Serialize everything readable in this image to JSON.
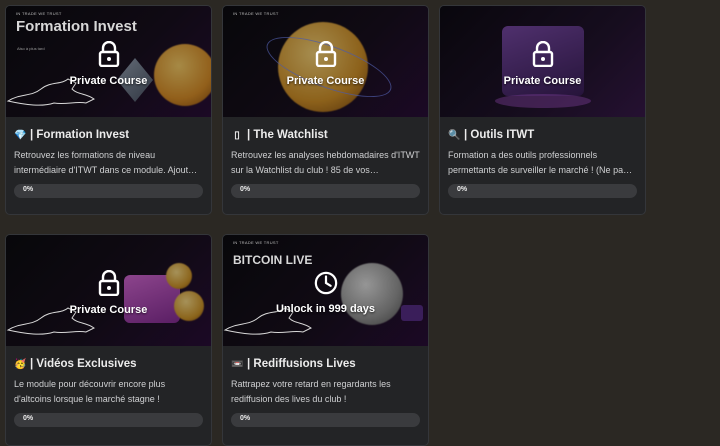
{
  "courses": [
    {
      "brand": "IN TRADE WE TRUST",
      "thumb_title": "Formation Invest",
      "thumb_sub": "Also à plus tard",
      "overlay": "Private Course",
      "emoji": "💎",
      "title": "| Formation Invest",
      "desc": "Retrouvez les formations de niveau intermédiaire d'ITWT dans ce module. Ajout…",
      "progress_label": "0%",
      "progress": 0,
      "accent": "#e8a72d",
      "icon": "lock-icon"
    },
    {
      "brand": "IN TRADE WE TRUST",
      "thumb_title": "",
      "overlay": "Private Course",
      "emoji": "▯",
      "title": "| The Watchlist",
      "desc": "Retrouvez les analyses hebdomadaires d'ITWT sur la Watchlist du club ! 85 de vos…",
      "progress_label": "0%",
      "progress": 0,
      "accent": "#d9a030",
      "icon": "lock-icon"
    },
    {
      "brand": "",
      "thumb_title": "",
      "overlay": "Private Course",
      "emoji": "🔍",
      "title": "| Outils ITWT",
      "desc": "Formation a des outils professionnels permettants de surveiller le marché ! (Ne pa…",
      "progress_label": "0%",
      "progress": 0,
      "accent": "#6a3d8f",
      "icon": "lock-icon"
    },
    {
      "brand": "",
      "thumb_title": "",
      "overlay": "Private Course",
      "emoji": "🥳",
      "title": "| Vidéos Exclusives",
      "desc": "Le module pour découvrir encore plus d'altcoins lorsque le marché stagne !",
      "progress_label": "0%",
      "progress": 0,
      "accent": "#b04ab8",
      "icon": "lock-icon"
    },
    {
      "brand": "IN TRADE WE TRUST",
      "thumb_title": "BITCOIN LIVE",
      "overlay": "Unlock in 999 days",
      "emoji": "📼",
      "title": "| Rediffusions Lives",
      "desc": "Rattrapez votre retard en regardants les rediffusion des lives du club !",
      "progress_label": "0%",
      "progress": 0,
      "accent": "#9a9a9a",
      "icon": "clock-icon"
    }
  ]
}
